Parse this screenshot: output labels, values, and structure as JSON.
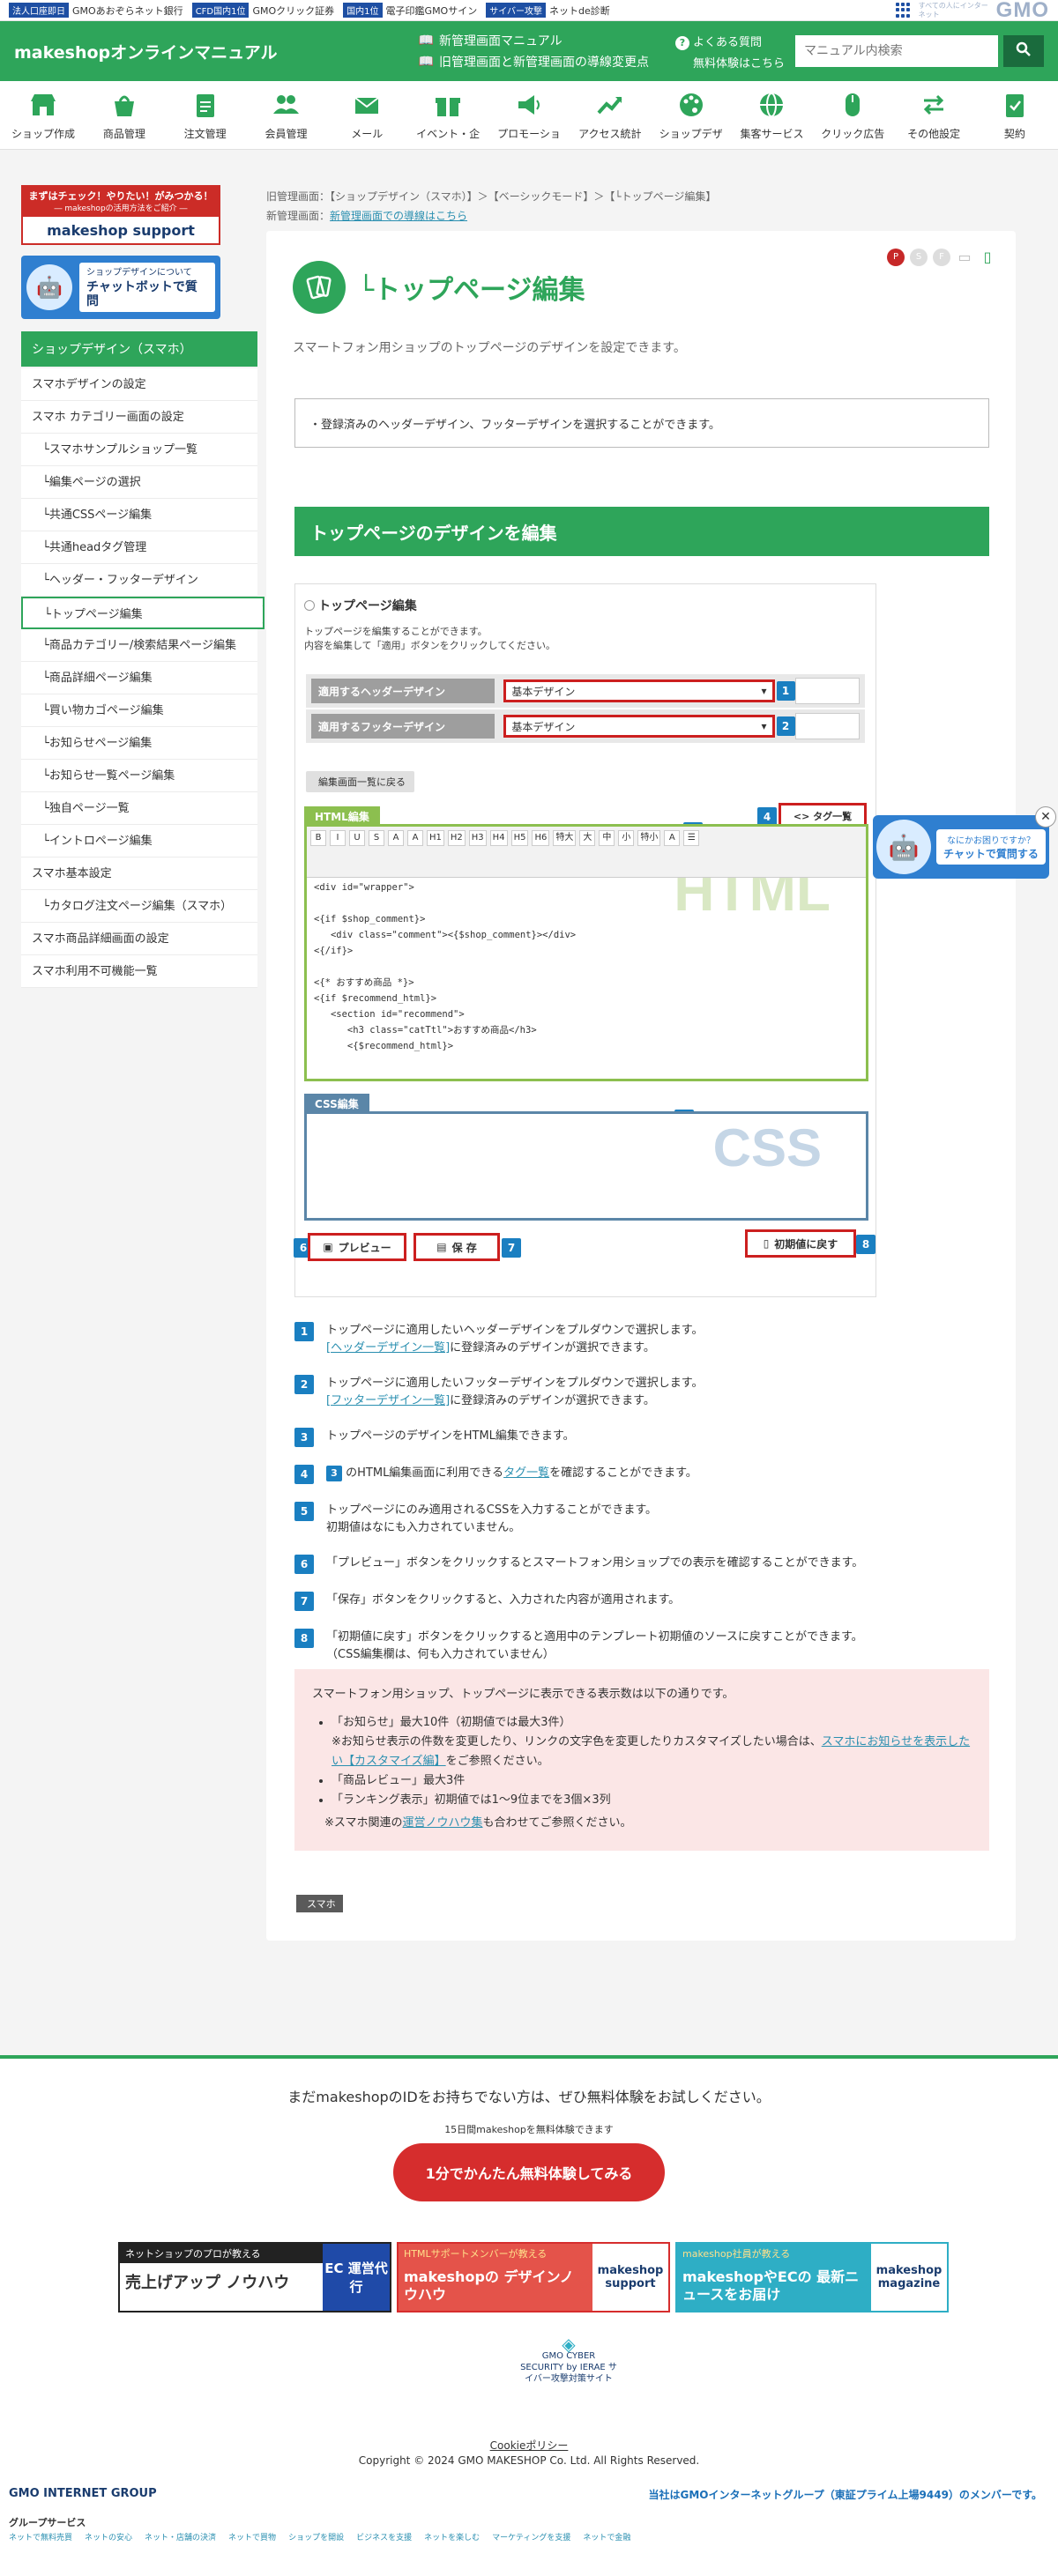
{
  "gmobar": {
    "items": [
      {
        "badge": "法人口座即日",
        "text": "GMOあおぞらネット銀行"
      },
      {
        "badge": "CFD国内1位",
        "text": "GMOクリック証券"
      },
      {
        "badge": "国内1位",
        "text": "電子印鑑GMOサイン"
      },
      {
        "badge": "サイバー攻撃",
        "text": "ネットde診断"
      }
    ],
    "logo": "GMO",
    "tagline": "すべての人にインターネット"
  },
  "header": {
    "title": "makeshopオンラインマニュアル",
    "link_new": "新管理画面マニュアル",
    "link_change": "旧管理画面と新管理画面の導線変更点",
    "faq": "よくある質問",
    "trial": "無料体験はこちら",
    "search_placeholder": "マニュアル内検索"
  },
  "nav": [
    "ショップ作成",
    "商品管理",
    "注文管理",
    "会員管理",
    "メール",
    "イベント・企",
    "プロモーショ",
    "アクセス統計",
    "ショップデザ",
    "集客サービス",
    "クリック広告",
    "その他設定",
    "契約"
  ],
  "breadcrumb": {
    "old_label": "旧管理画面：",
    "old_path": "【ショップデザイン（スマホ）】＞【ベーシックモード】＞【└トップページ編集】",
    "new_label": "新管理画面：",
    "new_link": "新管理画面での導線はこちら"
  },
  "banners": {
    "support_top": "まずはチェック！やりたい！がみつかる！",
    "support_sub": "― makeshopの活用方法をご紹介 ―",
    "support_brand": "makeshop support",
    "chat_small": "ショップデザインについて",
    "chat_big": "チャットボットで質問"
  },
  "sidebar": {
    "head": "ショップデザイン（スマホ）",
    "items": [
      {
        "label": "スマホデザインの設定",
        "level": 1
      },
      {
        "label": "スマホ カテゴリー画面の設定",
        "level": 1
      },
      {
        "label": "└スマホサンプルショップ一覧",
        "level": 2
      },
      {
        "label": "└編集ページの選択",
        "level": 2
      },
      {
        "label": "└共通CSSページ編集",
        "level": 2
      },
      {
        "label": "└共通headタグ管理",
        "level": 2
      },
      {
        "label": "└ヘッダー・フッターデザイン",
        "level": 2
      },
      {
        "label": "└トップページ編集",
        "level": 2,
        "active": true
      },
      {
        "label": "└商品カテゴリー/検索結果ページ編集",
        "level": 2
      },
      {
        "label": "└商品詳細ページ編集",
        "level": 2
      },
      {
        "label": "└買い物カゴページ編集",
        "level": 2
      },
      {
        "label": "└お知らせページ編集",
        "level": 2
      },
      {
        "label": "└お知らせ一覧ページ編集",
        "level": 2
      },
      {
        "label": "└独自ページ一覧",
        "level": 2
      },
      {
        "label": "└イントロページ編集",
        "level": 2
      },
      {
        "label": "スマホ基本設定",
        "level": 1
      },
      {
        "label": "└カタログ注文ページ編集（スマホ）",
        "level": 2
      },
      {
        "label": "スマホ商品詳細画面の設定",
        "level": 1
      },
      {
        "label": "スマホ利用不可機能一覧",
        "level": 1
      }
    ]
  },
  "page": {
    "title": "└トップページ編集",
    "lead": "スマートフォン用ショップのトップページのデザインを設定できます。",
    "note": "・登録済みのヘッダーデザイン、フッターデザインを選択することができます。",
    "section": "トップページのデザインを編集",
    "devices": [
      "P",
      "S",
      "F",
      "PC",
      "SP"
    ]
  },
  "figure": {
    "title": "トップページ編集",
    "desc1": "トップページを編集することができます。",
    "desc2": "内容を編集して「適用」ボタンをクリックしてください。",
    "header_label": "適用するヘッダーデザイン",
    "footer_label": "適用するフッターデザイン",
    "header_value": "基本デザイン",
    "footer_value": "基本デザイン",
    "back": "編集画面一覧に戻る",
    "html_label": "HTML編集",
    "css_label": "CSS編集",
    "tag_list": "<> タグ一覧",
    "html_wm": "HTML",
    "css_wm": "CSS",
    "preview": "プレビュー",
    "save": "保 存",
    "reset": "初期値に戻す",
    "code": "<div id=\"wrapper\">\n\n<{if $shop_comment}>\n   <div class=\"comment\"><{$shop_comment}></div>\n<{/if}>\n\n<{* おすすめ商品 *}>\n<{if $recommend_html}>\n   <section id=\"recommend\">\n      <h3 class=\"catTtl\">おすすめ商品</h3>\n      <{$recommend_html}>",
    "toolbar": [
      "B",
      "I",
      "U",
      "S",
      "A",
      "A",
      "H1",
      "H2",
      "H3",
      "H4",
      "H5",
      "H6",
      "特大",
      "大",
      "中",
      "小",
      "特小",
      "A",
      "☰"
    ]
  },
  "steps": [
    {
      "n": "1",
      "text": "トップページに適用したいヘッダーデザインをプルダウンで選択します。",
      "link": "[ヘッダーデザイン一覧]",
      "after": "に登録済みのデザインが選択できます。"
    },
    {
      "n": "2",
      "text": "トップページに適用したいフッターデザインをプルダウンで選択します。",
      "link": "[フッターデザイン一覧]",
      "after": "に登録済みのデザインが選択できます。"
    },
    {
      "n": "3",
      "text": "トップページのデザインをHTML編集できます。"
    },
    {
      "n": "4",
      "text": " のHTML編集画面に利用できる",
      "ref": "3",
      "link": "タグ一覧",
      "after": "を確認することができます。"
    },
    {
      "n": "5",
      "text": "トップページにのみ適用されるCSSを入力することができます。",
      "sub": "初期値はなにも入力されていません。"
    },
    {
      "n": "6",
      "text": "「プレビュー」ボタンをクリックするとスマートフォン用ショップでの表示を確認することができます。"
    },
    {
      "n": "7",
      "text": "「保存」ボタンをクリックすると、入力された内容が適用されます。"
    },
    {
      "n": "8",
      "text": "「初期値に戻す」ボタンをクリックすると適用中のテンプレート初期値のソースに戻すことができます。",
      "sub": "（CSS編集欄は、何も入力されていません）"
    }
  ],
  "pink": {
    "intro": "スマートフォン用ショップ、トップページに表示できる表示数は以下の通りです。",
    "b1": "「お知らせ」最大10件（初期値では最大3件）",
    "b1_sub": "※お知らせ表示の件数を変更したり、リンクの文字色を変更したりカスタマイズしたい場合は、",
    "b1_link": "スマホにお知らせを表示したい【カスタマイズ編】",
    "b1_after": "をご参照ください。",
    "b2": "「商品レビュー」最大3件",
    "b3": "「ランキング表示」初期値では1～9位までを3個×3列",
    "note": "※スマホ関連の",
    "note_link": "運営ノウハウ集",
    "note_after": "も合わせてご参照ください。"
  },
  "tag": "スマホ",
  "chatbot": {
    "q": "なにかお困りですか？",
    "a": "チャットで質問する"
  },
  "footer": {
    "lead": "まだmakeshopのIDをお持ちでない方は、ぜひ無料体験をお試しください。",
    "small": "15日間makeshopを無料体験できます",
    "trial": "1分でかんたん無料体験してみる",
    "banner1_top": "ネットショップのプロが教える",
    "banner1_main": "売上げアップ ノウハウ",
    "banner1_side": "EC 運営代行",
    "banner2_top": "HTMLサポートメンバーが教える",
    "banner2_main": "makeshopの デザインノウハウ",
    "banner2_side": "makeshop support",
    "banner3_top": "makeshop社員が教える",
    "banner3_main": "makeshopやECの 最新ニュースをお届け",
    "banner3_side": "makeshop magazine",
    "secure": "GMO CYBER SECURITY by IERAE サイバー攻撃対策サイト",
    "cookie": "Cookieポリシー",
    "copyright": "Copyright © 2024 GMO MAKESHOP Co. Ltd. All Rights Reserved.",
    "group": "GMO INTERNET GROUP",
    "group_note": "当社はGMOインターネットグループ（東証プライム上場9449）のメンバーです。",
    "services_title": "グループサービス",
    "services": [
      "ネットで無料売買",
      "ネットの安心",
      "ネット・店舗の決済",
      "ネットで買物",
      "ショップを開設",
      "ビジネスを支援",
      "ネットを楽しむ",
      "マーケティングを支援",
      "ネットで金融"
    ]
  }
}
